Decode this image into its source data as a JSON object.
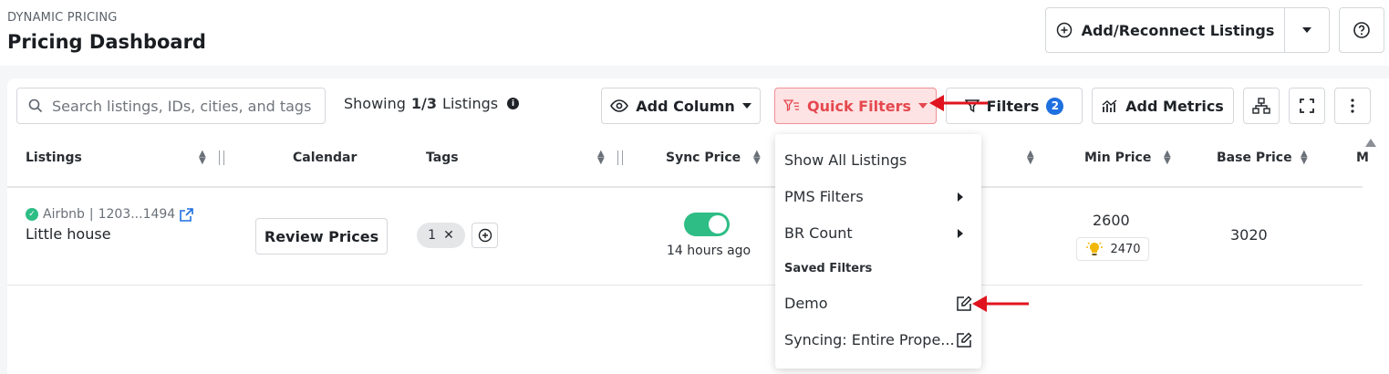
{
  "header": {
    "section_label": "DYNAMIC PRICING",
    "title": "Pricing Dashboard",
    "add_reconnect_label": "Add/Reconnect Listings"
  },
  "toolbar": {
    "search_placeholder": "Search listings, IDs, cities, and tags",
    "showing_prefix": "Showing",
    "showing_count": "1/3",
    "showing_suffix": "Listings",
    "add_column_label": "Add Column",
    "quick_filters_label": "Quick Filters",
    "filters_label": "Filters",
    "filters_count": "2",
    "add_metrics_label": "Add Metrics"
  },
  "table": {
    "columns": {
      "listings": "Listings",
      "calendar": "Calendar",
      "tags": "Tags",
      "sync_price": "Sync Price",
      "min_price": "Min Price",
      "base_price": "Base Price",
      "partial": "M"
    },
    "rows": [
      {
        "channel": "Airbnb",
        "listing_id": "1203...1494",
        "name": "Little house",
        "calendar_button": "Review Prices",
        "tag_count": "1",
        "sync_enabled": true,
        "sync_time": "14 hours ago",
        "min_price": "2600",
        "min_price_suggestion": "2470",
        "base_price": "3020"
      }
    ]
  },
  "quick_filters_menu": {
    "items": [
      "Show All Listings",
      "PMS Filters",
      "BR Count"
    ],
    "saved_filters_heading": "Saved Filters",
    "saved_filters": [
      "Demo",
      "Syncing: Entire Prope..."
    ]
  },
  "colors": {
    "accent_red": "#e5484f",
    "quick_filter_bg": "#fde3e4",
    "toggle_green": "#2ebd85",
    "badge_blue": "#1e6fe0",
    "annotation_arrow": "#e0141e"
  }
}
